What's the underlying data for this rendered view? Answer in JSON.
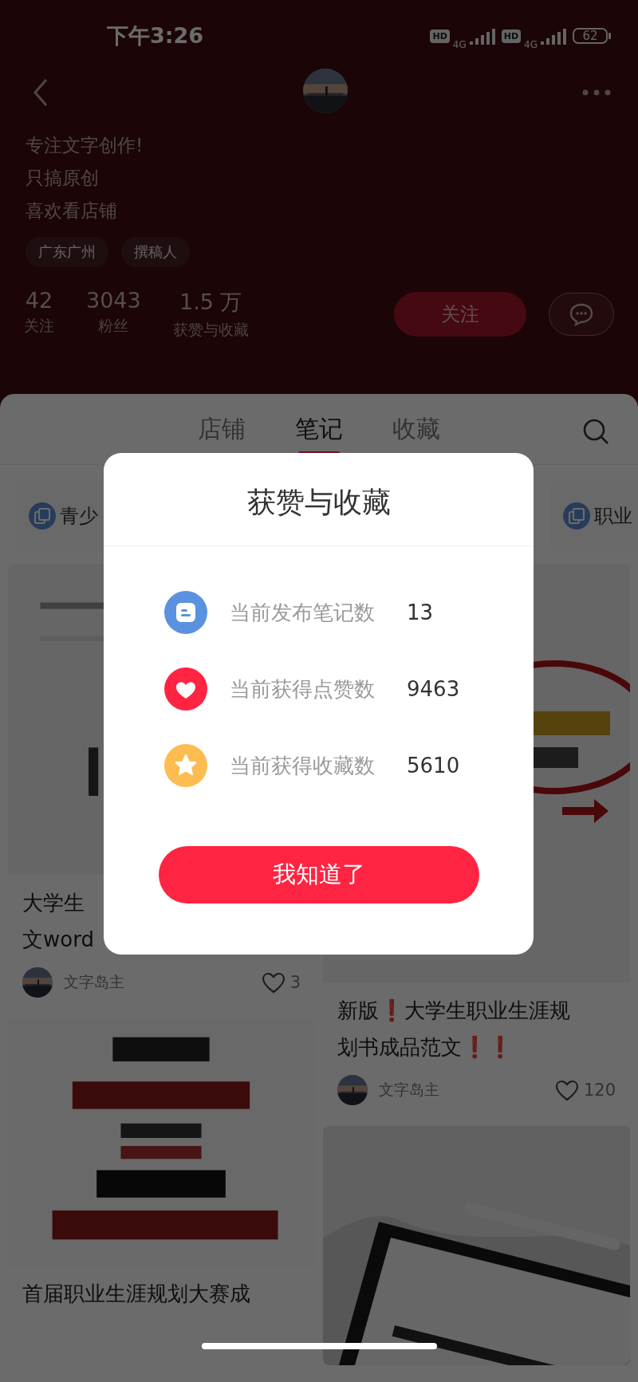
{
  "status_bar": {
    "time": "下午3:26",
    "networks": [
      {
        "badge": "HD",
        "type": "4G"
      },
      {
        "badge": "HD",
        "type": "4G"
      }
    ],
    "battery": "62"
  },
  "profile": {
    "bio": [
      "专注文字创作!",
      "只搞原创",
      "喜欢看店铺"
    ],
    "tags": [
      "广东广州",
      "撰稿人"
    ],
    "stats": [
      {
        "value": "42",
        "label": "关注"
      },
      {
        "value": "3043",
        "label": "粉丝"
      },
      {
        "value": "1.5 万",
        "label": "获赞与收藏"
      }
    ],
    "follow_button": "关注"
  },
  "tabs": [
    {
      "label": "店铺",
      "selected": false
    },
    {
      "label": "笔记",
      "selected": true
    },
    {
      "label": "收藏",
      "selected": false
    }
  ],
  "collections": [
    "青少",
    "职业"
  ],
  "note_columns": [
    {
      "notes": [
        {
          "cover": {
            "kind": "picture"
          },
          "title_lines": [
            "大学生",
            "文word"
          ],
          "author": "文字岛主",
          "likes": "3"
        },
        {
          "cover": {
            "kind": "picture"
          },
          "title_lines": [
            "首届职业生涯规划大赛成"
          ]
        }
      ]
    },
    {
      "notes": [
        {
          "cover": {
            "kind": "picture"
          },
          "title_lines": [
            "新版❗大学生职业生涯规",
            "划书成品范文❗❗"
          ],
          "author": "文字岛主",
          "likes": "120"
        },
        {
          "cover": {
            "kind": "picture"
          }
        }
      ]
    }
  ],
  "modal": {
    "title": "获赞与收藏",
    "rows": [
      {
        "kind": "notes",
        "label": "当前发布笔记数",
        "value": "13"
      },
      {
        "kind": "likes",
        "label": "当前获得点赞数",
        "value": "9463"
      },
      {
        "kind": "favorites",
        "label": "当前获得收藏数",
        "value": "5610"
      }
    ],
    "button": "我知道了"
  }
}
